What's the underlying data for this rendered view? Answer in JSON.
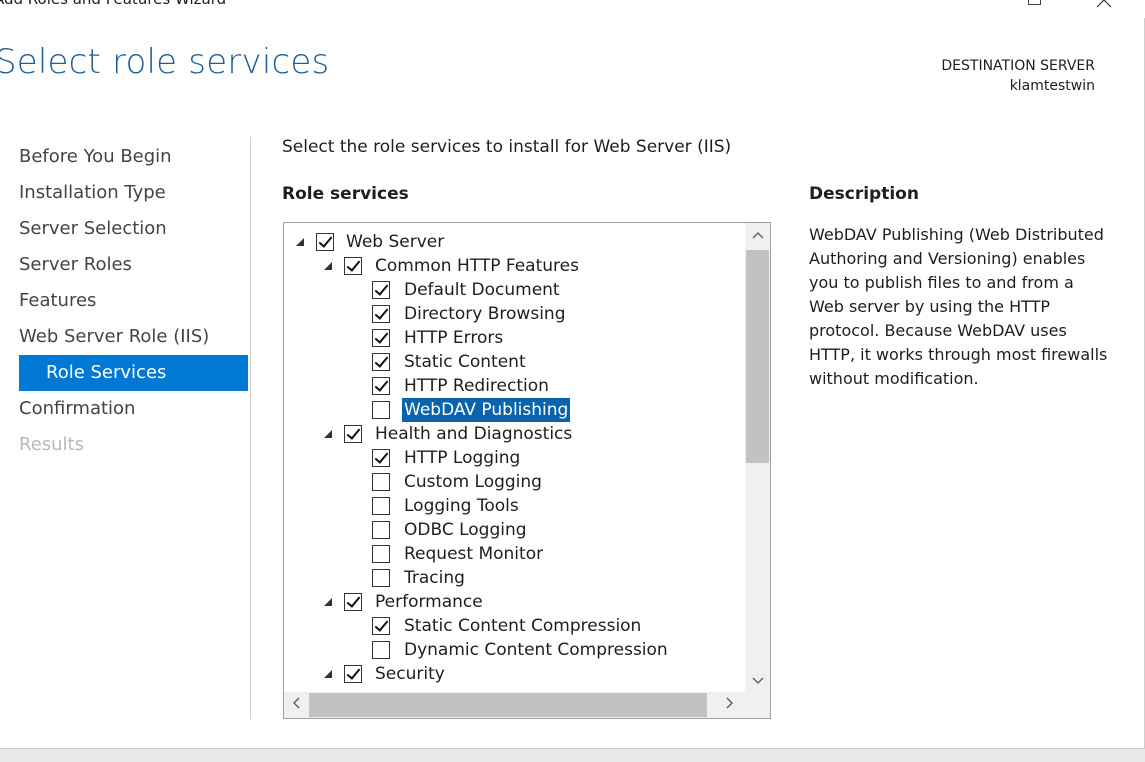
{
  "window": {
    "title": "Add Roles and Features Wizard"
  },
  "page": {
    "title": "Select role services"
  },
  "destination": {
    "label": "DESTINATION SERVER",
    "server": "klamtestwin"
  },
  "nav": {
    "items": [
      {
        "label": "Before You Begin",
        "state": "normal"
      },
      {
        "label": "Installation Type",
        "state": "normal"
      },
      {
        "label": "Server Selection",
        "state": "normal"
      },
      {
        "label": "Server Roles",
        "state": "normal"
      },
      {
        "label": "Features",
        "state": "normal"
      },
      {
        "label": "Web Server Role (IIS)",
        "state": "normal"
      },
      {
        "label": "Role Services",
        "state": "active"
      },
      {
        "label": "Confirmation",
        "state": "normal"
      },
      {
        "label": "Results",
        "state": "disabled"
      }
    ]
  },
  "main": {
    "instruction": "Select the role services to install for Web Server (IIS)",
    "role_services_heading": "Role services",
    "tree": [
      {
        "label": "Web Server",
        "level": 0,
        "checked": true,
        "expandable": true
      },
      {
        "label": "Common HTTP Features",
        "level": 1,
        "checked": true,
        "expandable": true
      },
      {
        "label": "Default Document",
        "level": 2,
        "checked": true
      },
      {
        "label": "Directory Browsing",
        "level": 2,
        "checked": true
      },
      {
        "label": "HTTP Errors",
        "level": 2,
        "checked": true
      },
      {
        "label": "Static Content",
        "level": 2,
        "checked": true
      },
      {
        "label": "HTTP Redirection",
        "level": 2,
        "checked": true
      },
      {
        "label": "WebDAV Publishing",
        "level": 2,
        "checked": false,
        "selected": true
      },
      {
        "label": "Health and Diagnostics",
        "level": 1,
        "checked": true,
        "expandable": true
      },
      {
        "label": "HTTP Logging",
        "level": 2,
        "checked": true
      },
      {
        "label": "Custom Logging",
        "level": 2,
        "checked": false
      },
      {
        "label": "Logging Tools",
        "level": 2,
        "checked": false
      },
      {
        "label": "ODBC Logging",
        "level": 2,
        "checked": false
      },
      {
        "label": "Request Monitor",
        "level": 2,
        "checked": false
      },
      {
        "label": "Tracing",
        "level": 2,
        "checked": false
      },
      {
        "label": "Performance",
        "level": 1,
        "checked": true,
        "expandable": true
      },
      {
        "label": "Static Content Compression",
        "level": 2,
        "checked": true
      },
      {
        "label": "Dynamic Content Compression",
        "level": 2,
        "checked": false
      },
      {
        "label": "Security",
        "level": 1,
        "checked": true,
        "expandable": true
      }
    ]
  },
  "description": {
    "heading": "Description",
    "text": "WebDAV Publishing (Web Distributed Authoring and Versioning) enables you to publish files to and from a Web server by using the HTTP protocol. Because WebDAV uses HTTP, it works through most firewalls without modification."
  },
  "icons": {
    "expand": "triangle-expanded-icon",
    "scroll_up": "chevron-up-icon",
    "scroll_down": "chevron-down-icon",
    "scroll_left": "chevron-left-icon",
    "scroll_right": "chevron-right-icon"
  },
  "colors": {
    "title": "#1f5d95",
    "accent": "#0078d4",
    "selection": "#0a64ad"
  }
}
